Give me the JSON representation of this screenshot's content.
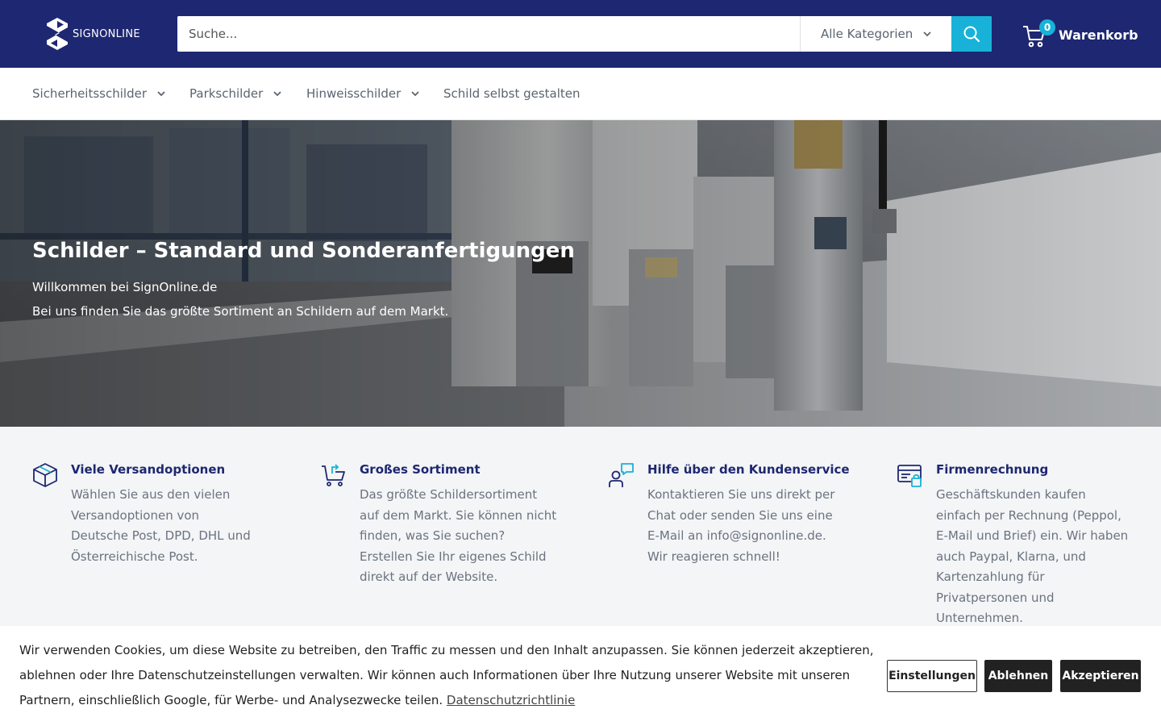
{
  "header": {
    "logo_text": "SIGNONLINE",
    "search_placeholder": "Suche...",
    "category_select": "Alle Kategorien",
    "cart_count": "0",
    "cart_label": "Warenkorb"
  },
  "nav": {
    "items": [
      {
        "label": "Sicherheitsschilder",
        "has_dropdown": true
      },
      {
        "label": "Parkschilder",
        "has_dropdown": true
      },
      {
        "label": "Hinweisschilder",
        "has_dropdown": true
      },
      {
        "label": "Schild selbst gestalten",
        "has_dropdown": false
      }
    ]
  },
  "hero": {
    "title": "Schilder – Standard und Sonderanfertigungen",
    "subtitle1": "Willkommen bei SignOnline.de",
    "subtitle2": "Bei uns finden Sie das größte Sortiment an Schildern auf dem Markt."
  },
  "features": [
    {
      "icon": "box-icon",
      "title": "Viele Versandoptionen",
      "text": "Wählen Sie aus den vielen Versandoptionen von Deutsche Post, DPD, DHL und Österreichische Post."
    },
    {
      "icon": "cart-return-icon",
      "title": "Großes Sortiment",
      "text": "Das größte Schildersortiment auf dem Markt. Sie können nicht finden, was Sie suchen? Erstellen Sie Ihr eigenes Schild direkt auf der Website."
    },
    {
      "icon": "support-chat-icon",
      "title": "Hilfe über den Kundenservice",
      "text": "Kontaktieren Sie uns direkt per Chat oder senden Sie uns eine E-Mail an info@signonline.de. Wir reagieren schnell!"
    },
    {
      "icon": "invoice-card-icon",
      "title": "Firmenrechnung",
      "text": "Geschäftskunden kaufen einfach per Rechnung (Peppol, E-Mail und Brief) ein. Wir haben auch Paypal, Klarna, und Kartenzahlung für Privatpersonen und Unternehmen."
    }
  ],
  "cookie": {
    "text": "Wir verwenden Cookies, um diese Website zu betreiben, den Traffic zu messen und den Inhalt anzupassen. Sie können jederzeit akzeptieren, ablehnen oder Ihre Datenschutzeinstellungen verwalten. Wir können auch Informationen über Ihre Nutzung unserer Website mit unseren Partnern, einschließlich Google, für Werbe- und Analysezwecke teilen.",
    "link": "Datenschutzrichtlinie",
    "settings_label": "Einstellungen",
    "decline_label": "Ablehnen",
    "accept_label": "Akzeptieren"
  },
  "colors": {
    "brand_navy": "#1e2771",
    "accent_cyan": "#18b2d8",
    "feature_title": "#1e2771",
    "feature_text": "#6b7380"
  }
}
